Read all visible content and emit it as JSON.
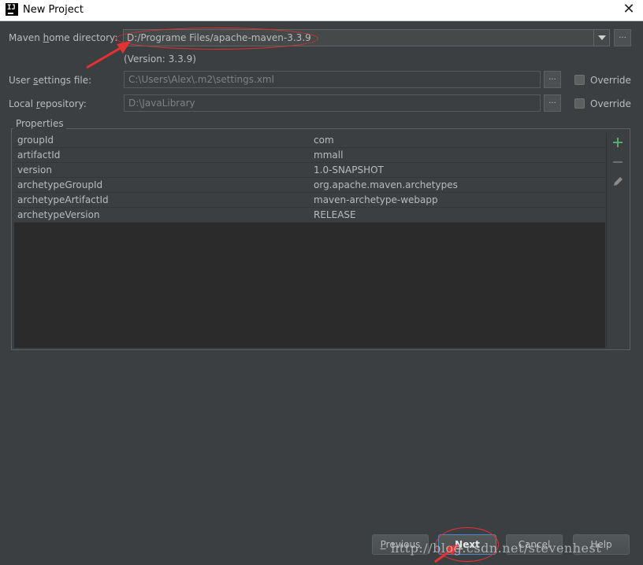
{
  "window": {
    "title": "New Project",
    "close_icon": "close-icon"
  },
  "maven": {
    "home_label_pre": "Maven ",
    "home_label_ul": "h",
    "home_label_post": "ome directory:",
    "home_value": "D:/Programe Files/apache-maven-3.3.9",
    "version_text": "(Version: 3.3.9)",
    "browse_label": "..."
  },
  "user_settings": {
    "label_pre": "User ",
    "label_ul": "s",
    "label_post": "ettings file:",
    "value": "C:\\Users\\Alex\\.m2\\settings.xml",
    "browse_label": "...",
    "override_label": "Override"
  },
  "local_repo": {
    "label_pre": "Local ",
    "label_ul": "r",
    "label_post": "epository:",
    "value": "D:\\JavaLibrary",
    "browse_label": "...",
    "override_label": "Override"
  },
  "properties": {
    "legend": "Properties",
    "rows": [
      {
        "key": "groupId",
        "value": "com"
      },
      {
        "key": "artifactId",
        "value": "mmall"
      },
      {
        "key": "version",
        "value": "1.0-SNAPSHOT"
      },
      {
        "key": "archetypeGroupId",
        "value": "org.apache.maven.archetypes"
      },
      {
        "key": "archetypeArtifactId",
        "value": "maven-archetype-webapp"
      },
      {
        "key": "archetypeVersion",
        "value": "RELEASE"
      }
    ],
    "tools": [
      "plus-icon",
      "minus-icon",
      "pencil-icon"
    ]
  },
  "buttons": {
    "previous_ul": "P",
    "previous_rest": "revious",
    "next_ul": "N",
    "next_rest": "ext",
    "cancel": "Cancel",
    "help": "Help"
  },
  "watermark": "http://blog.csdn.net/stevenhest",
  "colors": {
    "background": "#3c3f41",
    "accent": "#4a88c7",
    "annotation": "#e63232",
    "add": "#59a869"
  }
}
